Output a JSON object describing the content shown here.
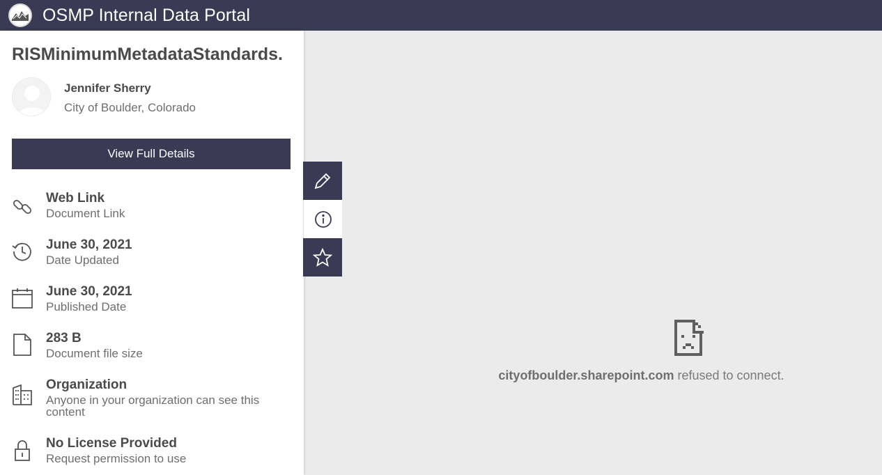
{
  "header": {
    "app_title": "OSMP Internal Data Portal"
  },
  "item": {
    "title": "RISMinimumMetadataStandards.",
    "owner_name": "Jennifer Sherry",
    "owner_org": "City of Boulder, Colorado",
    "view_button": "View Full Details"
  },
  "info": [
    {
      "main": "Web Link",
      "sub": "Document Link",
      "icon": "link-icon"
    },
    {
      "main": "June 30, 2021",
      "sub": "Date Updated",
      "icon": "history-icon"
    },
    {
      "main": "June 30, 2021",
      "sub": "Published Date",
      "icon": "calendar-icon"
    },
    {
      "main": "283 B",
      "sub": "Document file size",
      "icon": "file-icon"
    },
    {
      "main": "Organization",
      "sub": "Anyone in your organization can see this content",
      "icon": "building-icon"
    },
    {
      "main": "No License Provided",
      "sub": "Request permission to use",
      "icon": "lock-icon"
    }
  ],
  "tools": [
    "pencil-icon",
    "info-icon",
    "star-icon"
  ],
  "error": {
    "host": "cityofboulder.sharepoint.com",
    "message": " refused to connect."
  },
  "colors": {
    "header_bg": "#3b3a55",
    "page_bg": "#ebebeb"
  }
}
